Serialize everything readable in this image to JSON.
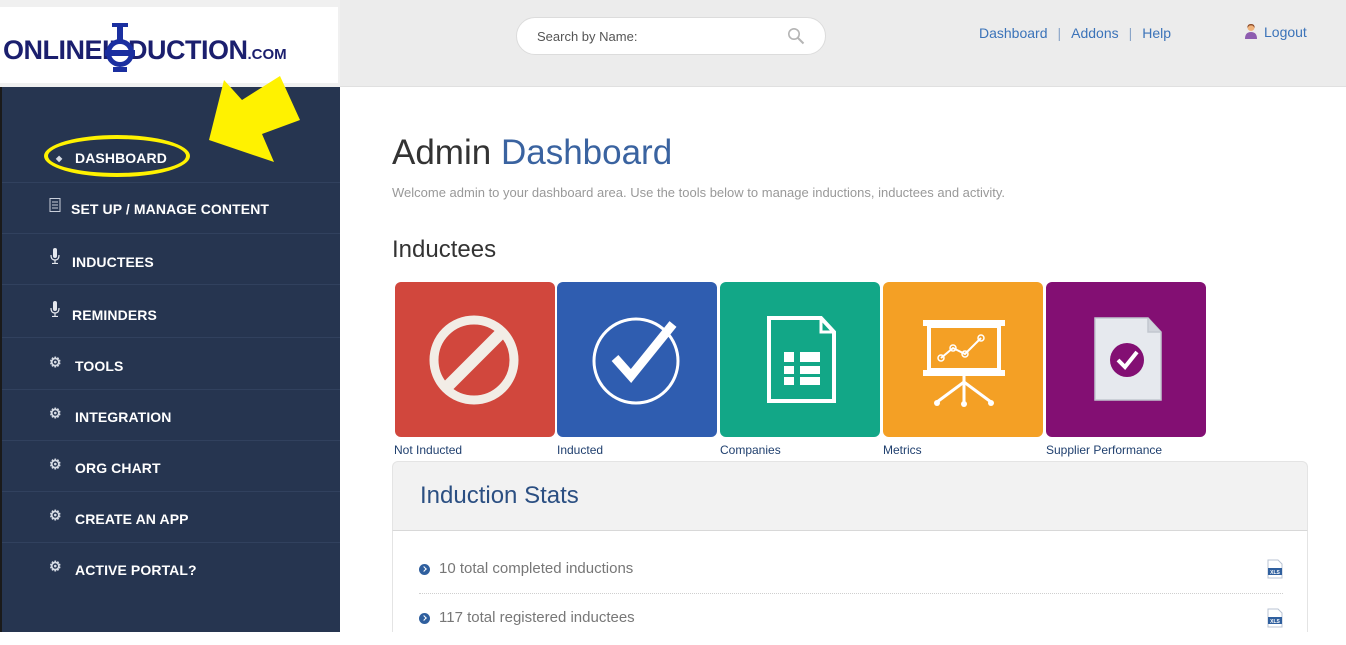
{
  "logo": {
    "text": "ONLINEINDUCTION",
    "suffix": ".COM"
  },
  "search": {
    "placeholder": "Search by Name:"
  },
  "topnav": {
    "dashboard": "Dashboard",
    "addons": "Addons",
    "help": "Help",
    "logout": "Logout"
  },
  "sidebar": {
    "items": [
      {
        "label": "Dashboard",
        "icon": "dashboard-icon"
      },
      {
        "label": "Set Up / Manage Content",
        "icon": "document-icon"
      },
      {
        "label": "Inductees",
        "icon": "microphone-icon"
      },
      {
        "label": "Reminders",
        "icon": "microphone-icon"
      },
      {
        "label": "Tools",
        "icon": "gear-icon"
      },
      {
        "label": "Integration",
        "icon": "gear-icon"
      },
      {
        "label": "Org Chart",
        "icon": "gear-icon"
      },
      {
        "label": "Create An App",
        "icon": "gear-icon"
      },
      {
        "label": "Active Portal?",
        "icon": "gear-icon"
      }
    ],
    "active": "Dashboard"
  },
  "main": {
    "title_plain": "Admin",
    "title_accent": "Dashboard",
    "welcome": "Welcome admin to your dashboard area. Use the tools below to manage inductions, inductees and activity.",
    "section": "Inductees",
    "tiles": [
      {
        "label": "Not Inducted",
        "color": "#d1473d",
        "icon": "no-entry-icon"
      },
      {
        "label": "Inducted",
        "color": "#2f5db0",
        "icon": "checkmark-circle-icon"
      },
      {
        "label": "Companies",
        "color": "#12a787",
        "icon": "document-list-icon"
      },
      {
        "label": "Metrics",
        "color": "#f4a025",
        "icon": "presentation-chart-icon"
      },
      {
        "label": "Supplier Performance",
        "color": "#830f73",
        "icon": "document-check-icon"
      }
    ]
  },
  "stats": {
    "title": "Induction Stats",
    "rows": [
      {
        "text": "10 total completed inductions",
        "export": "XLS"
      },
      {
        "text": "117 total registered inductees",
        "export": "XLS"
      }
    ]
  },
  "colors": {
    "sidebar": "#263550",
    "accent": "#3a63a0",
    "highlight": "#fff200"
  }
}
